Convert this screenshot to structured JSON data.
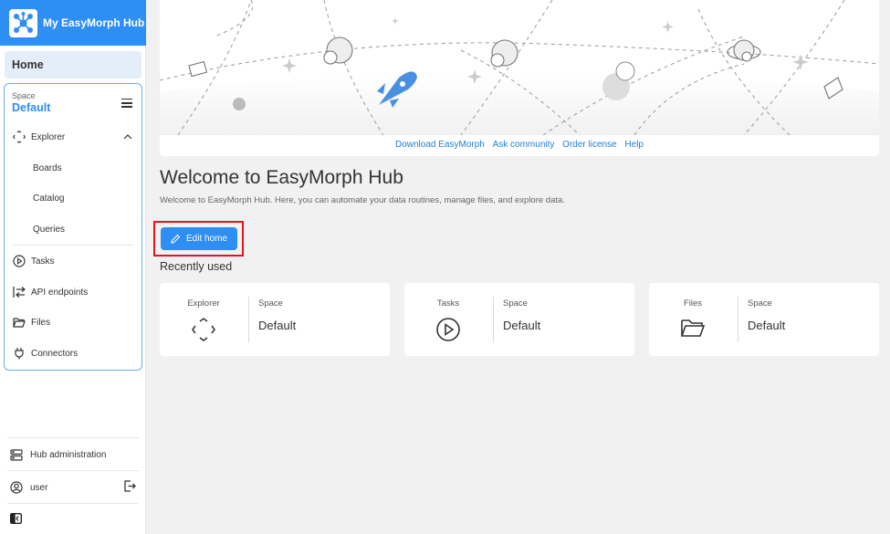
{
  "brand": {
    "title": "My EasyMorph Hub"
  },
  "sidebar": {
    "home_label": "Home",
    "space": {
      "label": "Space",
      "name": "Default"
    },
    "explorer_label": "Explorer",
    "explorer_children": [
      "Boards",
      "Catalog",
      "Queries"
    ],
    "items": [
      {
        "label": "Tasks",
        "icon": "play-circle-icon"
      },
      {
        "label": "API endpoints",
        "icon": "api-arrows-icon"
      },
      {
        "label": "Files",
        "icon": "folder-icon"
      },
      {
        "label": "Connectors",
        "icon": "plug-icon"
      }
    ],
    "hub_admin_label": "Hub administration",
    "user_label": "user"
  },
  "banner": {
    "links": [
      "Download EasyMorph",
      "Ask community",
      "Order license",
      "Help"
    ]
  },
  "welcome": {
    "title": "Welcome to EasyMorph Hub",
    "text": "Welcome to EasyMorph Hub. Here, you can automate your data routines, manage files, and explore data.",
    "edit_button": "Edit home"
  },
  "recent": {
    "title": "Recently used",
    "cards": [
      {
        "kind": "Explorer",
        "space_label": "Space",
        "space_name": "Default",
        "icon": "explorer-diamond-icon"
      },
      {
        "kind": "Tasks",
        "space_label": "Space",
        "space_name": "Default",
        "icon": "play-circle-icon"
      },
      {
        "kind": "Files",
        "space_label": "Space",
        "space_name": "Default",
        "icon": "folder-icon"
      }
    ]
  },
  "colors": {
    "accent": "#2d8ef3",
    "highlight": "#e0161d",
    "link": "#1e7fd9"
  }
}
